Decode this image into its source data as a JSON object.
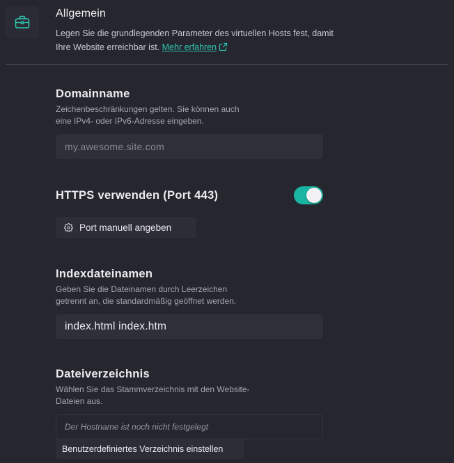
{
  "section": {
    "icon": "briefcase-icon",
    "title": "Allgemein",
    "desc_line1": "Legen Sie die grundlegenden Parameter des virtuellen Hosts fest, damit",
    "desc_line2": "Ihre Website erreichbar ist.",
    "learn_more": "Mehr erfahren",
    "learn_more_icon": "external-link-icon"
  },
  "domain": {
    "title": "Domainname",
    "help_line1": "Zeichenbeschränkungen gelten. Sie können auch",
    "help_line2": "eine IPv4- oder IPv6-Adresse eingeben.",
    "placeholder": "my.awesome.site.com",
    "value": ""
  },
  "https": {
    "label": "HTTPS verwenden (Port 443)",
    "enabled": true,
    "port_button": "Port manuell angeben",
    "port_button_icon": "gear-icon"
  },
  "index": {
    "title": "Indexdateinamen",
    "help_line1": "Geben Sie die Dateinamen durch Leerzeichen",
    "help_line2": "getrennt an, die standardmäßig geöffnet werden.",
    "value": "index.html index.htm"
  },
  "docroot": {
    "title": "Dateiverzeichnis",
    "help_line1": "Wählen Sie das Stammverzeichnis mit den Website-",
    "help_line2": "Dateien aus.",
    "status": "Der Hostname ist noch nicht festgelegt",
    "button": "Benutzerdefiniertes Verzeichnis einstellen"
  },
  "colors": {
    "background": "#26262f",
    "accent": "#19b5a2",
    "link": "#2ec4b1",
    "input_bg": "#2f2f39"
  }
}
